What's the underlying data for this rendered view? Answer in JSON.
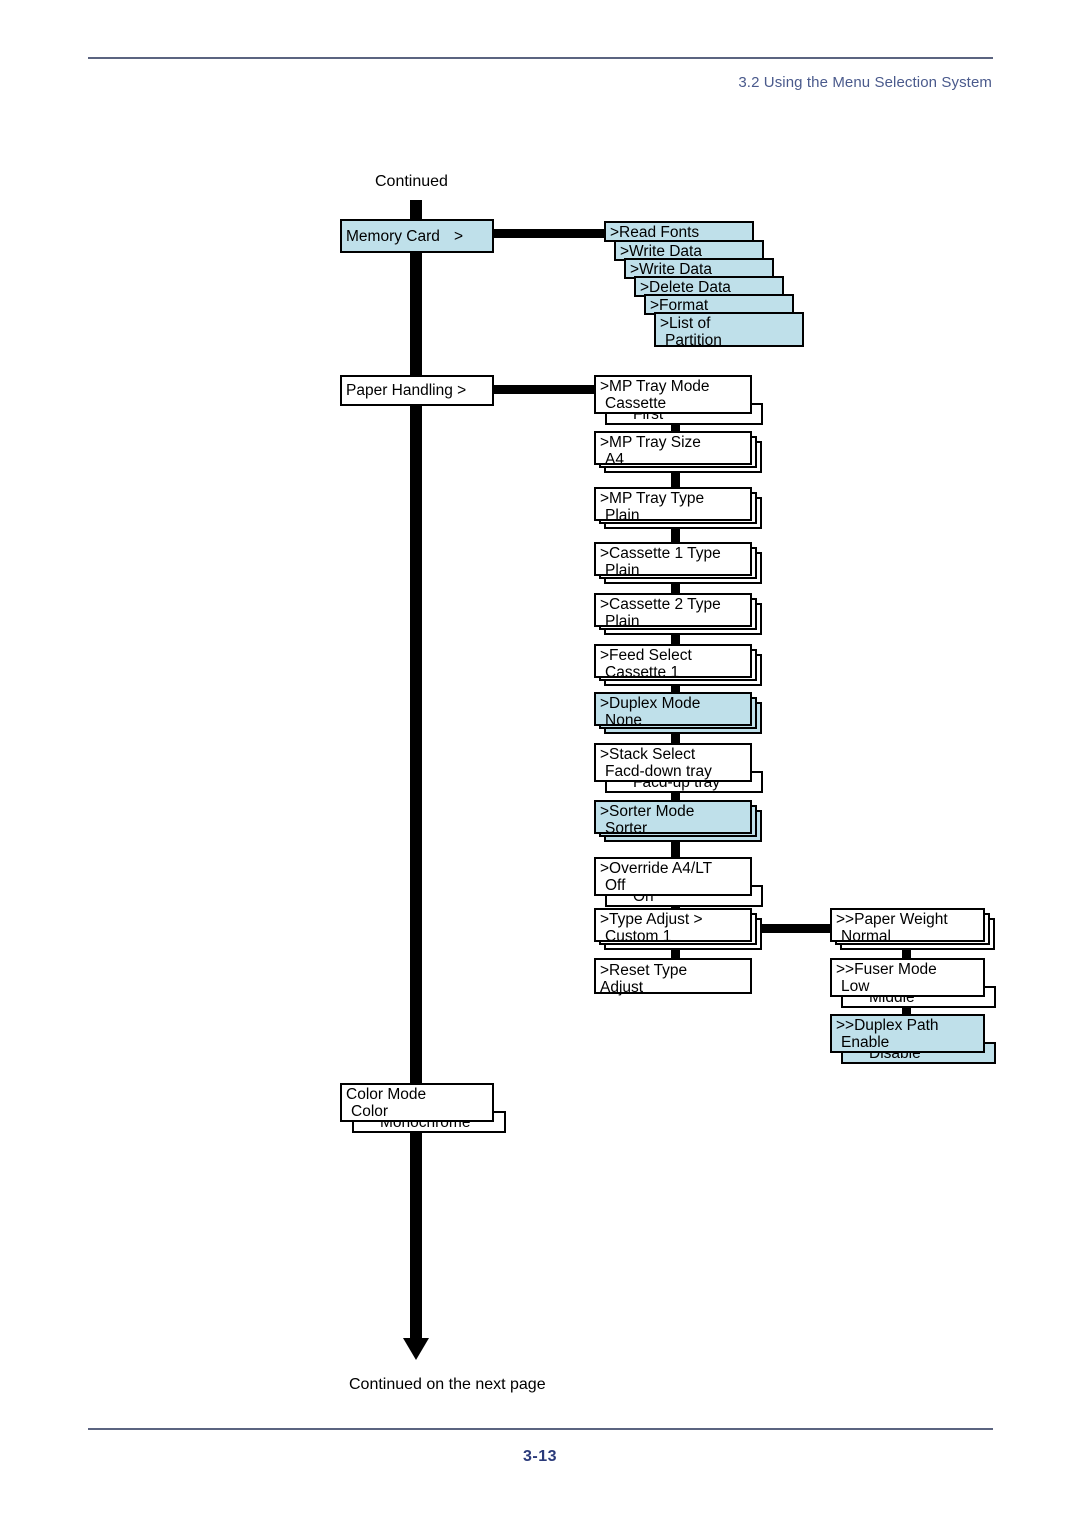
{
  "header": {
    "section_title": "3.2 Using the Menu Selection System"
  },
  "footer": {
    "page_number": "3-13"
  },
  "flow": {
    "top_caption": "Continued",
    "bottom_caption": "Continued on the next page"
  },
  "menu_tree": {
    "branches": [
      {
        "id": "memory-card",
        "label": "Memory Card",
        "arrow": ">",
        "highlighted": true,
        "cascade": [
          {
            "label": ">Read Fonts"
          },
          {
            "label": ">Write Data"
          },
          {
            "label": ">Write Data"
          },
          {
            "label": ">Delete Data"
          },
          {
            "label": ">Format"
          },
          {
            "label": ">List of",
            "label2": "Partition"
          }
        ]
      },
      {
        "id": "paper-handling",
        "label": "Paper Handling >",
        "highlighted": false,
        "items": [
          {
            "id": "mp-tray-mode",
            "title": ">MP Tray Mode",
            "value": "Cassette",
            "extra": "First",
            "highlighted": false,
            "stack": 0
          },
          {
            "id": "mp-tray-size",
            "title": ">MP Tray Size",
            "value": "A4",
            "extra": null,
            "highlighted": false,
            "stack": 2
          },
          {
            "id": "mp-tray-type",
            "title": ">MP Tray Type",
            "value": "Plain",
            "extra": null,
            "highlighted": false,
            "stack": 2
          },
          {
            "id": "cassette-1-type",
            "title": ">Cassette 1 Type",
            "value": "Plain",
            "extra": null,
            "highlighted": false,
            "stack": 2
          },
          {
            "id": "cassette-2-type",
            "title": ">Cassette 2 Type",
            "value": "Plain",
            "extra": null,
            "highlighted": false,
            "stack": 2
          },
          {
            "id": "feed-select",
            "title": ">Feed Select",
            "value": "Cassette 1",
            "extra": null,
            "highlighted": false,
            "stack": 2
          },
          {
            "id": "duplex-mode",
            "title": ">Duplex Mode",
            "value": "None",
            "extra": null,
            "highlighted": true,
            "stack": 2
          },
          {
            "id": "stack-select",
            "title": ">Stack Select",
            "value": "Facd-down tray",
            "extra": "Facd-up tray",
            "highlighted": false,
            "stack": 0
          },
          {
            "id": "sorter-mode",
            "title": ">Sorter Mode",
            "value": "Sorter",
            "extra": null,
            "highlighted": true,
            "stack": 2
          },
          {
            "id": "override-a4lt",
            "title": ">Override A4/LT",
            "value": "Off",
            "extra": "On",
            "highlighted": false,
            "stack": 0
          },
          {
            "id": "type-adjust",
            "title": ">Type Adjust   >",
            "value": "Custom 1",
            "extra": null,
            "highlighted": false,
            "stack": 2
          },
          {
            "id": "reset-type",
            "title": ">Reset Type",
            "value": "Adjust",
            "extra": null,
            "highlighted": false,
            "stack": 0
          }
        ],
        "sub_items": [
          {
            "id": "paper-weight",
            "title": ">>Paper Weight",
            "value": "Normal",
            "extra": null,
            "highlighted": false,
            "stack": 2
          },
          {
            "id": "fuser-mode",
            "title": ">>Fuser Mode",
            "value": "Low",
            "extra": "Middle",
            "highlighted": false,
            "stack": 0
          },
          {
            "id": "duplex-path",
            "title": ">>Duplex Path",
            "value": "Enable",
            "extra": "Disable",
            "highlighted": true,
            "stack": 0
          }
        ]
      },
      {
        "id": "color-mode",
        "label": "Color Mode",
        "value": "Color",
        "extra": "Monochrome",
        "highlighted": false
      }
    ]
  },
  "colors": {
    "highlight_fill": "#bfe0ea",
    "box_border": "#000000",
    "header_blue": "#4a5a8c",
    "page_number_blue": "#2a3a7a",
    "rule": "#5b6480"
  }
}
